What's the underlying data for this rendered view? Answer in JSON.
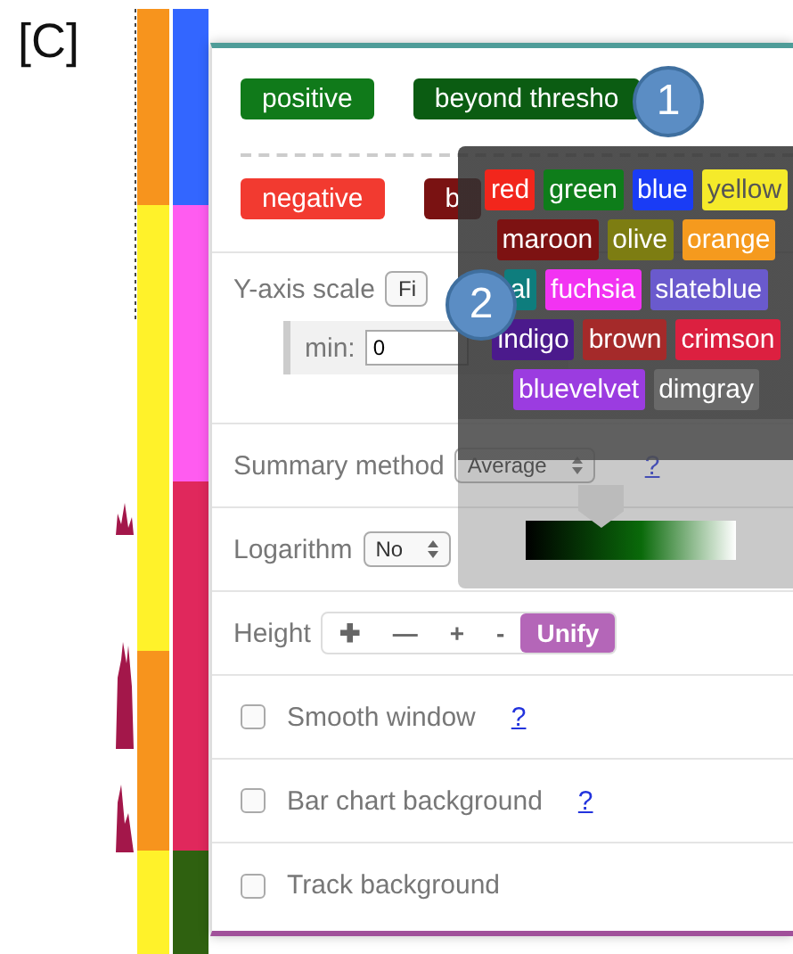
{
  "figure_label": "[C]",
  "legend": [
    [
      {
        "label": "positive",
        "color": "#107a1a"
      },
      {
        "label": "beyond thresho",
        "color": "#0b5c12"
      }
    ],
    [
      {
        "label": "negative",
        "color": "#f23a30"
      },
      {
        "label": "b",
        "color": "#7a1212"
      }
    ]
  ],
  "settings": [
    {
      "kind": "axis",
      "label": "Y-axis scale",
      "select": "Fi",
      "sub_label": "min:",
      "sub_value": "0"
    },
    {
      "kind": "select",
      "label": "Summary method",
      "select": "Average",
      "help": "?"
    },
    {
      "kind": "select",
      "label": "Logarithm",
      "select": "No"
    },
    {
      "kind": "buttons",
      "label": "Height",
      "buttons": [
        {
          "label": "✚",
          "highlighted": false
        },
        {
          "label": "—",
          "highlighted": false
        },
        {
          "label": "+",
          "highlighted": false
        },
        {
          "label": "-",
          "highlighted": false
        },
        {
          "label": "Unify",
          "highlighted": true
        }
      ]
    },
    {
      "kind": "checkbox",
      "label": "Smooth window",
      "checked": false,
      "help": "?"
    },
    {
      "kind": "checkbox",
      "label": "Bar chart background",
      "checked": false,
      "help": "?"
    },
    {
      "kind": "checkbox",
      "label": "Track background",
      "checked": false
    }
  ],
  "palette": {
    "rows": [
      [
        {
          "label": "red",
          "color": "#f2261c"
        },
        {
          "label": "green",
          "color": "#0e7d1a"
        },
        {
          "label": "blue",
          "color": "#1a3cf5"
        },
        {
          "label": "yellow",
          "color": "#f5ea2a"
        }
      ],
      [
        {
          "label": "maroon",
          "color": "#7d1212"
        },
        {
          "label": "olive",
          "color": "#7d7d12"
        },
        {
          "label": "orange",
          "color": "#f59a1e"
        }
      ],
      [
        {
          "label": "al",
          "color": "#0e7d7d"
        },
        {
          "label": "fuchsia",
          "color": "#f233f2"
        },
        {
          "label": "slateblue",
          "color": "#6a5acd"
        }
      ],
      [
        {
          "label": "indigo",
          "color": "#4b1a8c"
        },
        {
          "label": "brown",
          "color": "#a52a2a"
        },
        {
          "label": "crimson",
          "color": "#dc2040"
        }
      ],
      [
        {
          "label": "bluevelvet",
          "color": "#9b3ce0"
        },
        {
          "label": "dimgray",
          "color": "#696969"
        }
      ]
    ],
    "slider": {
      "level": 0.36
    }
  },
  "badges": [
    "1",
    "2"
  ]
}
